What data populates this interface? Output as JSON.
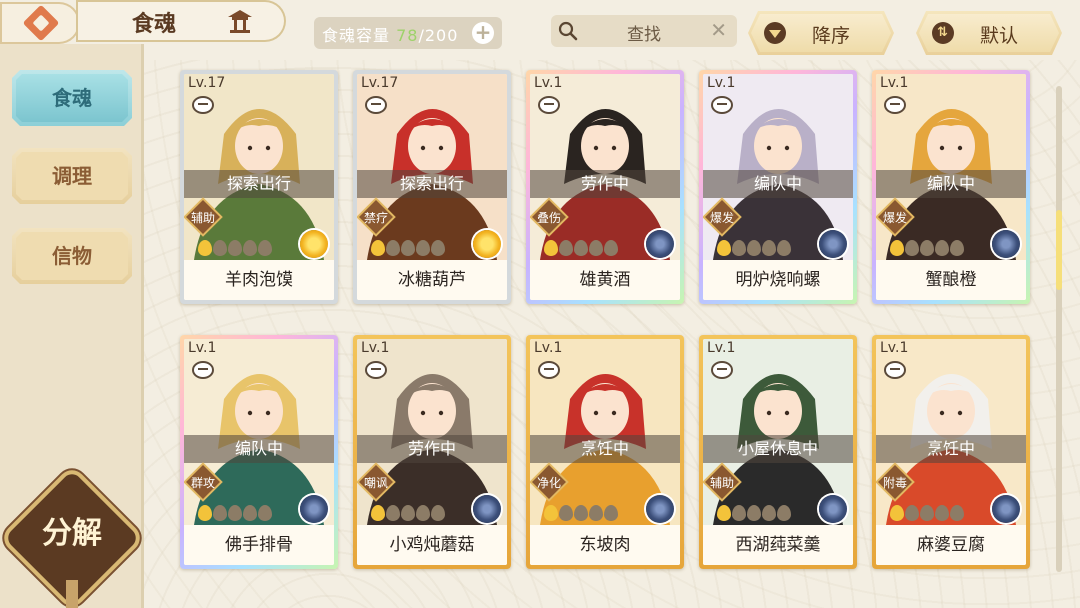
{
  "header": {
    "title": "食魂",
    "capacity_label": "食魂容量",
    "capacity_current": "78",
    "capacity_max": "/200",
    "search_placeholder": "查找",
    "sort_order_label": "降序",
    "sort_type_label": "默认"
  },
  "sidebar": {
    "items": [
      {
        "label": "食魂",
        "active": true
      },
      {
        "label": "调理",
        "active": false
      },
      {
        "label": "信物",
        "active": false
      }
    ],
    "decompose_label": "分解"
  },
  "colors": {
    "accent_gold": "#e9c06a",
    "active_tab": "#8ccfd7",
    "capacity_current": "#9ed26a",
    "status_overlay": "#504640"
  },
  "cards": [
    {
      "level": "Lv.17",
      "status": "探索出行",
      "role": "辅助",
      "name": "羊肉泡馍",
      "stars_lit": 1,
      "frame": "silver",
      "badge": "gold",
      "palette": [
        "#f1e6c8",
        "#d8b15a",
        "#5a7a3a"
      ]
    },
    {
      "level": "Lv.17",
      "status": "探索出行",
      "role": "禁疗",
      "name": "冰糖葫芦",
      "stars_lit": 1,
      "frame": "silver",
      "badge": "gold",
      "palette": [
        "#f6e0c8",
        "#c8302a",
        "#6b3a1e"
      ]
    },
    {
      "level": "Lv.1",
      "status": "劳作中",
      "role": "叠伤",
      "name": "雄黄酒",
      "stars_lit": 1,
      "frame": "rainbow",
      "badge": "navy",
      "palette": [
        "#f5ecd8",
        "#2a2420",
        "#9a2c26"
      ]
    },
    {
      "level": "Lv.1",
      "status": "编队中",
      "role": "爆发",
      "name": "明炉烧响螺",
      "stars_lit": 1,
      "frame": "rainbow",
      "badge": "navy",
      "palette": [
        "#efeaf2",
        "#b9b0c8",
        "#3a3238"
      ]
    },
    {
      "level": "Lv.1",
      "status": "编队中",
      "role": "爆发",
      "name": "蟹酿橙",
      "stars_lit": 1,
      "frame": "rainbow",
      "badge": "navy",
      "palette": [
        "#f7e7c8",
        "#e5a63d",
        "#3a2a24"
      ]
    },
    {
      "level": "Lv.1",
      "status": "编队中",
      "role": "群攻",
      "name": "佛手排骨",
      "stars_lit": 1,
      "frame": "rainbow",
      "badge": "navy",
      "palette": [
        "#f6ecd4",
        "#e8c46a",
        "#2e6a5a"
      ]
    },
    {
      "level": "Lv.1",
      "status": "劳作中",
      "role": "嘲讽",
      "name": "小鸡炖蘑菇",
      "stars_lit": 1,
      "frame": "gold",
      "badge": "navy",
      "palette": [
        "#efe4cc",
        "#8a7a6a",
        "#3b2e28"
      ]
    },
    {
      "level": "Lv.1",
      "status": "烹饪中",
      "role": "净化",
      "name": "东坡肉",
      "stars_lit": 1,
      "frame": "gold",
      "badge": "navy",
      "palette": [
        "#f7e6c0",
        "#c8322a",
        "#e8a02e"
      ]
    },
    {
      "level": "Lv.1",
      "status": "小屋休息中",
      "role": "辅助",
      "name": "西湖莼菜羹",
      "stars_lit": 1,
      "frame": "gold",
      "badge": "navy",
      "palette": [
        "#e9efe4",
        "#3d5a3a",
        "#2a2a2a"
      ]
    },
    {
      "level": "Lv.1",
      "status": "烹饪中",
      "role": "附毒",
      "name": "麻婆豆腐",
      "stars_lit": 1,
      "frame": "gold",
      "badge": "navy",
      "palette": [
        "#f8e8c8",
        "#f2f0ec",
        "#d94a2a"
      ]
    }
  ]
}
